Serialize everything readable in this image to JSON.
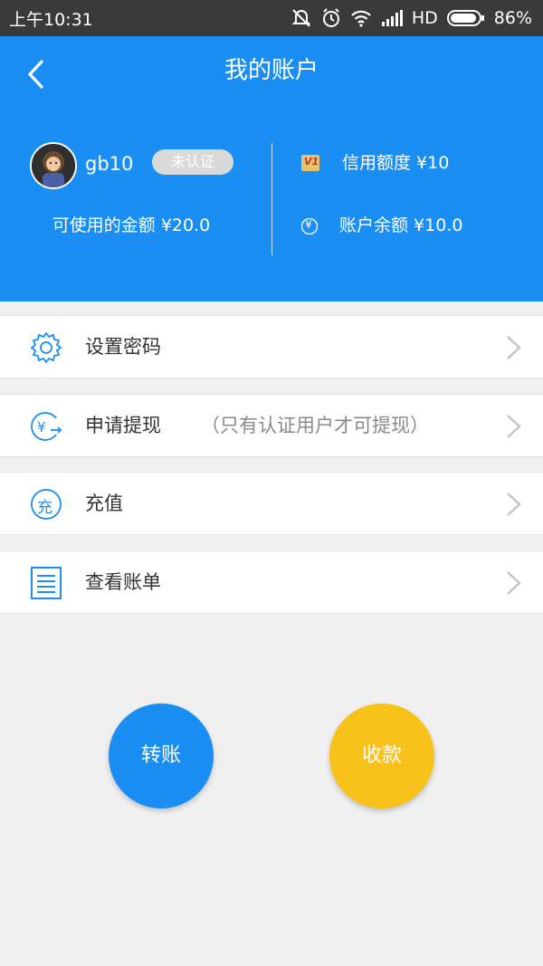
{
  "status_bar": {
    "time": "上午10:31",
    "network": "HD",
    "battery": "86%"
  },
  "header": {
    "title": "我的账户"
  },
  "account": {
    "username": "gb10",
    "verify_badge": "未认证",
    "available_amount": "可使用的金额 ¥20.0",
    "credit_limit": "信用额度 ¥10",
    "account_balance": "账户余额 ¥10.0",
    "credit_icon_text": "V1",
    "balance_icon_text": "¥"
  },
  "menu": {
    "items": [
      {
        "label": "设置密码",
        "note": "",
        "icon": "gear-icon"
      },
      {
        "label": "申请提现",
        "note": "（只有认证用户才可提现）",
        "icon": "withdraw-icon"
      },
      {
        "label": "充值",
        "note": "",
        "icon": "recharge-icon"
      },
      {
        "label": "查看账单",
        "note": "",
        "icon": "bill-icon"
      }
    ],
    "recharge_icon_text": "充"
  },
  "actions": {
    "transfer": "转账",
    "receive": "收款"
  },
  "colors": {
    "primary": "#1a8ef2",
    "receive": "#f9c21b",
    "badge": "#d9d9d9"
  }
}
